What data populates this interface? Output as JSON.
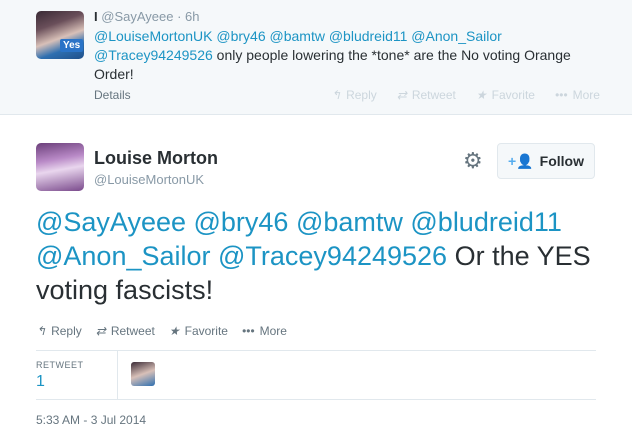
{
  "parent_tweet": {
    "name": "I",
    "handle": "@SayAyeee",
    "time": "· 6h",
    "mentions": "@LouiseMortonUK @bry46 @bamtw @bludreid11 @Anon_Sailor @Tracey94249526",
    "text": " only people lowering the *tone* are the No voting Orange Order!",
    "details_label": "Details",
    "actions": {
      "reply": "Reply",
      "retweet": "Retweet",
      "favorite": "Favorite",
      "more": "More"
    },
    "avatar_badge": "Yes"
  },
  "main_tweet": {
    "name": "Louise Morton",
    "handle": "@LouiseMortonUK",
    "follow_label": "Follow",
    "mentions": "@SayAyeee @bry46 @bamtw @bludreid11 @Anon_Sailor @Tracey94249526",
    "text": " Or the YES voting fascists!",
    "actions": {
      "reply": "Reply",
      "retweet": "Retweet",
      "favorite": "Favorite",
      "more": "More"
    },
    "stats": {
      "retweet_label": "RETWEET",
      "retweet_count": "1"
    },
    "timestamp": "5:33 AM - 3 Jul 2014"
  },
  "icons": {
    "reply": "reply-icon",
    "retweet": "retweet-icon",
    "favorite": "star-icon",
    "more": "more-icon",
    "gear": "gear-icon",
    "follow": "follow-user-icon"
  },
  "colors": {
    "link": "#1c94c4",
    "accent": "#55acee",
    "muted": "#66757f",
    "bg_parent": "#f5f8fa"
  }
}
